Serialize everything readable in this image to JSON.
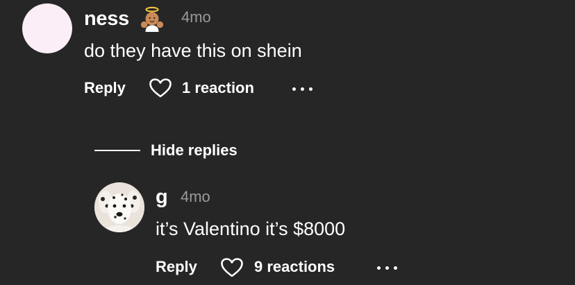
{
  "comment": {
    "username": "ness",
    "username_emoji_icon": "angel-baby-emoji-icon",
    "timestamp": "4mo",
    "text": "do they have this on shein",
    "reply_label": "Reply",
    "reactions_label": "1 reaction",
    "avatar_color": "#fbeef6"
  },
  "thread": {
    "hide_replies_label": "Hide replies"
  },
  "reply": {
    "username": "g",
    "timestamp": "4mo",
    "text": "it’s Valentino it’s $8000",
    "reply_label": "Reply",
    "reactions_label": "9 reactions",
    "avatar_icon": "dalmatian-dog-avatar"
  },
  "colors": {
    "background": "#262626",
    "text_primary": "#ffffff",
    "text_muted": "#9a9a9a"
  },
  "icons": {
    "heart": "heart-outline-icon",
    "more": "more-options-icon"
  }
}
